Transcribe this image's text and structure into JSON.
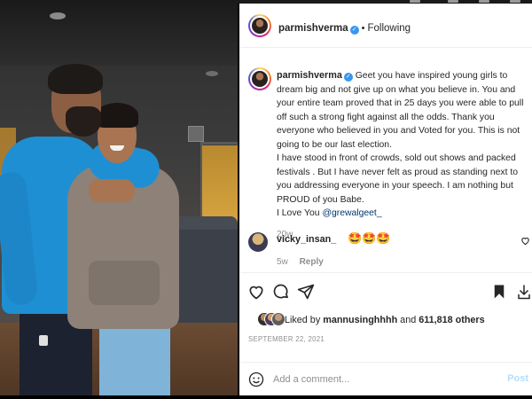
{
  "post": {
    "header": {
      "username": "parmishverma",
      "follow_status": "Following"
    },
    "caption": {
      "username": "parmishverma",
      "text": "Geet you have inspired young girls to dream big and not give up on what you believe in. You and your entire team proved that in 25 days you were able to pull off such a strong fight against all the odds. Thank you everyone who believed in you and Voted for you. This is not going to be our last election.",
      "text2": "I have stood in front of crowds, sold out shows and packed festivals . But I have never felt as proud as standing next to you addressing everyone in your speech. I am nothing but PROUD of you Babe.",
      "text3_prefix": "I Love You ",
      "mention": "@grewalgeet_",
      "time": "20w"
    },
    "comments": [
      {
        "username": "vicky_insan_",
        "text": "🤩🤩🤩",
        "time": "5w",
        "reply_label": "Reply"
      }
    ],
    "likes": {
      "prefix": "Liked by ",
      "user": "mannusinghhhh",
      "middle": " and ",
      "count": "611,818 others"
    },
    "date": "SEPTEMBER 22, 2021",
    "comment_input": {
      "placeholder": "Add a comment..."
    },
    "post_button": "Post"
  },
  "colors": {
    "accent_blue": "#3897f0",
    "mention_blue": "#00376b",
    "muted_gray": "#8e8e8e",
    "post_button_disabled": "#b2dffc"
  },
  "icons": [
    "more-icon",
    "heart-icon",
    "comment-icon",
    "share-icon",
    "save-icon",
    "emoji-icon",
    "verified-icon"
  ]
}
